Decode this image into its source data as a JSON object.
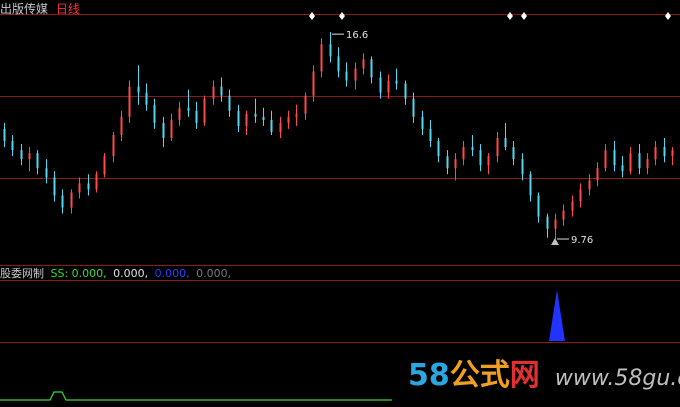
{
  "header": {
    "title": "出版传媒",
    "period": "日线"
  },
  "indicator": {
    "name": "股委网制",
    "values": [
      {
        "text": "SS: 0.000,",
        "color": "#33dd33"
      },
      {
        "text": "0.000,",
        "color": "#e0e0e0"
      },
      {
        "text": "0.000,",
        "color": "#2244ff"
      },
      {
        "text": "0.000,",
        "color": "#777777"
      }
    ]
  },
  "watermark": {
    "digits": "58",
    "cjk": "公式",
    "net": "网",
    "url": "www.58gu.com"
  },
  "colors": {
    "up": "#ff4a4a",
    "down": "#50d8f0",
    "grid": "#8a1a1a",
    "indicator_line": "#33dd33",
    "indicator_spike": "#2233ff"
  },
  "chart_data": {
    "type": "candlestick",
    "ylim": [
      9.0,
      17.2
    ],
    "max_label": "16.6",
    "min_label": "9.76",
    "candles": [
      [
        13.4,
        13.6,
        12.8,
        13.0
      ],
      [
        13.0,
        13.2,
        12.5,
        12.7
      ],
      [
        12.7,
        12.9,
        12.2,
        12.4
      ],
      [
        12.4,
        12.8,
        12.0,
        12.6
      ],
      [
        12.6,
        12.7,
        11.9,
        12.1
      ],
      [
        12.1,
        12.4,
        11.6,
        11.8
      ],
      [
        11.8,
        12.0,
        11.0,
        11.2
      ],
      [
        11.2,
        11.4,
        10.6,
        10.8
      ],
      [
        10.8,
        11.4,
        10.6,
        11.3
      ],
      [
        11.3,
        11.8,
        11.1,
        11.6
      ],
      [
        11.6,
        11.9,
        11.2,
        11.4
      ],
      [
        11.4,
        12.0,
        11.3,
        11.9
      ],
      [
        11.9,
        12.6,
        11.8,
        12.5
      ],
      [
        12.5,
        13.3,
        12.3,
        13.2
      ],
      [
        13.2,
        14.0,
        13.0,
        13.8
      ],
      [
        13.8,
        15.0,
        13.6,
        14.8
      ],
      [
        14.8,
        15.5,
        14.2,
        14.6
      ],
      [
        14.6,
        14.9,
        14.0,
        14.2
      ],
      [
        14.2,
        14.4,
        13.4,
        13.6
      ],
      [
        13.6,
        13.8,
        12.8,
        13.1
      ],
      [
        13.1,
        13.9,
        13.0,
        13.7
      ],
      [
        13.7,
        14.3,
        13.5,
        14.1
      ],
      [
        14.1,
        14.7,
        13.8,
        14.0
      ],
      [
        14.0,
        14.3,
        13.4,
        13.6
      ],
      [
        13.6,
        14.5,
        13.5,
        14.4
      ],
      [
        14.4,
        15.0,
        14.2,
        14.8
      ],
      [
        14.8,
        15.1,
        14.3,
        14.5
      ],
      [
        14.5,
        14.7,
        13.8,
        14.0
      ],
      [
        14.0,
        14.2,
        13.3,
        13.5
      ],
      [
        13.5,
        14.0,
        13.2,
        13.9
      ],
      [
        13.9,
        14.4,
        13.6,
        13.8
      ],
      [
        13.8,
        14.1,
        13.5,
        13.7
      ],
      [
        13.7,
        14.0,
        13.2,
        13.3
      ],
      [
        13.3,
        13.8,
        13.1,
        13.6
      ],
      [
        13.6,
        14.0,
        13.4,
        13.8
      ],
      [
        13.8,
        14.2,
        13.5,
        13.9
      ],
      [
        13.9,
        14.6,
        13.7,
        14.5
      ],
      [
        14.5,
        15.5,
        14.3,
        15.3
      ],
      [
        15.3,
        16.4,
        15.1,
        16.2
      ],
      [
        16.2,
        16.6,
        15.6,
        15.8
      ],
      [
        15.8,
        16.1,
        15.1,
        15.3
      ],
      [
        15.3,
        15.6,
        14.8,
        15.0
      ],
      [
        15.0,
        15.6,
        14.7,
        15.4
      ],
      [
        15.4,
        15.9,
        15.2,
        15.7
      ],
      [
        15.7,
        15.8,
        14.9,
        15.1
      ],
      [
        15.1,
        15.3,
        14.4,
        14.6
      ],
      [
        14.6,
        15.2,
        14.4,
        15.0
      ],
      [
        15.0,
        15.4,
        14.7,
        14.9
      ],
      [
        14.9,
        15.0,
        14.2,
        14.4
      ],
      [
        14.4,
        14.6,
        13.6,
        13.8
      ],
      [
        13.8,
        14.0,
        13.2,
        13.4
      ],
      [
        13.4,
        13.7,
        12.8,
        13.0
      ],
      [
        13.0,
        13.1,
        12.3,
        12.5
      ],
      [
        12.5,
        12.7,
        11.9,
        12.1
      ],
      [
        12.1,
        12.6,
        11.7,
        12.4
      ],
      [
        12.4,
        13.0,
        12.2,
        12.8
      ],
      [
        12.8,
        13.2,
        12.5,
        12.7
      ],
      [
        12.7,
        12.9,
        12.0,
        12.2
      ],
      [
        12.2,
        12.6,
        11.9,
        12.5
      ],
      [
        12.5,
        13.3,
        12.3,
        13.1
      ],
      [
        13.1,
        13.6,
        12.7,
        12.8
      ],
      [
        12.8,
        13.0,
        12.2,
        12.4
      ],
      [
        12.4,
        12.6,
        11.7,
        11.9
      ],
      [
        11.9,
        12.0,
        11.0,
        11.2
      ],
      [
        11.2,
        11.3,
        10.3,
        10.5
      ],
      [
        10.5,
        10.6,
        9.8,
        10.1
      ],
      [
        10.1,
        10.6,
        9.76,
        10.4
      ],
      [
        10.4,
        10.9,
        10.2,
        10.7
      ],
      [
        10.7,
        11.2,
        10.5,
        11.0
      ],
      [
        11.0,
        11.6,
        10.8,
        11.4
      ],
      [
        11.4,
        11.9,
        11.2,
        11.7
      ],
      [
        11.7,
        12.3,
        11.5,
        12.1
      ],
      [
        12.1,
        12.9,
        12.0,
        12.7
      ],
      [
        12.7,
        13.0,
        12.0,
        12.2
      ],
      [
        12.2,
        12.5,
        11.8,
        12.0
      ],
      [
        12.0,
        12.8,
        11.9,
        12.6
      ],
      [
        12.6,
        12.9,
        11.9,
        12.1
      ],
      [
        12.1,
        12.6,
        11.9,
        12.4
      ],
      [
        12.4,
        13.0,
        12.2,
        12.8
      ],
      [
        12.8,
        13.1,
        12.3,
        12.5
      ],
      [
        12.5,
        12.8,
        12.2,
        12.7
      ]
    ],
    "indicator": {
      "series": [
        {
          "name": "SS",
          "values_note": "",
          "bump_index": 9
        }
      ]
    }
  }
}
